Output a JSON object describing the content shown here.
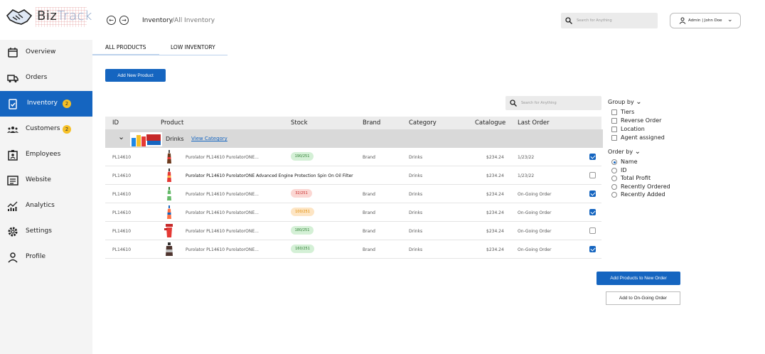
{
  "app": {
    "brand_first": "Biz",
    "brand_second": "Track"
  },
  "colors": {
    "primary": "#1565c0",
    "badge": "#f6c026",
    "sidebar_bg": "#f4f4f4"
  },
  "sidebar": {
    "items": [
      {
        "label": "Overview",
        "icon": "calendar-icon"
      },
      {
        "label": "Orders",
        "icon": "truck-icon"
      },
      {
        "label": "Inventory",
        "icon": "clipboard-check-icon",
        "badge": "2",
        "active": true
      },
      {
        "label": "Customers",
        "icon": "users-icon",
        "badge": "2"
      },
      {
        "label": "Employees",
        "icon": "id-badge-icon"
      },
      {
        "label": "Website",
        "icon": "browser-icon"
      },
      {
        "label": "Analytics",
        "icon": "chart-icon"
      },
      {
        "label": "Settings",
        "icon": "gear-icon"
      },
      {
        "label": "Profile",
        "icon": "user-icon"
      }
    ]
  },
  "topbar": {
    "breadcrumb_current": "Inventory",
    "breadcrumb_sub": "/All Inventory",
    "search_placeholder": "Search for Anything",
    "user_label": "Admin | John Doe"
  },
  "tabs": [
    {
      "label": "ALL PRODUCTS",
      "active": true
    },
    {
      "label": "LOW INVENTORY"
    }
  ],
  "add_product_label": "Add New Product",
  "table_search_placeholder": "Search for Anything",
  "table": {
    "columns": [
      "ID",
      "Product",
      "Stock",
      "Brand",
      "Category",
      "Catalogue",
      "Last Order"
    ],
    "group": {
      "name": "Drinks",
      "link": "View Category"
    },
    "rows": [
      {
        "id": "PL14610",
        "product": "Purolator PL14610 PurolatorONE...",
        "stock": "190/251",
        "stock_tone": "green",
        "brand": "Brand",
        "category": "Drinks",
        "catalogue": "$234.24",
        "last_order": "1/23/22",
        "checked": true
      },
      {
        "id": "PL14610",
        "product": "Purolator PL14610 PurolatorONE Advanced Engine Protection Spin On Oil Filter",
        "stock": "",
        "stock_tone": "",
        "brand": "",
        "category": "Drinks",
        "catalogue": "$234.24",
        "last_order": "1/23/22",
        "checked": false
      },
      {
        "id": "PL14610",
        "product": "Purolator PL14610 PurolatorONE...",
        "stock": "32/251",
        "stock_tone": "red",
        "brand": "Brand",
        "category": "Drinks",
        "catalogue": "$234.24",
        "last_order": "On-Going Order",
        "checked": true
      },
      {
        "id": "PL14610",
        "product": "Purolator PL14610 PurolatorONE...",
        "stock": "100/251",
        "stock_tone": "orange",
        "brand": "Brand",
        "category": "Drinks",
        "catalogue": "$234.24",
        "last_order": "On-Going Order",
        "checked": true
      },
      {
        "id": "PL14610",
        "product": "Purolator PL14610 PurolatorONE...",
        "stock": "180/251",
        "stock_tone": "green",
        "brand": "Brand",
        "category": "Drinks",
        "catalogue": "$234.24",
        "last_order": "On-Going Order",
        "checked": false
      },
      {
        "id": "PL14610",
        "product": "Purolator PL14610 PurolatorONE...",
        "stock": "160/251",
        "stock_tone": "green",
        "brand": "Brand",
        "category": "Drinks",
        "catalogue": "$234.24",
        "last_order": "On-Going Order",
        "checked": true
      }
    ]
  },
  "filters": {
    "group_by_label": "Group by",
    "group_by": [
      "Tiers",
      "Reverse Order",
      "Location",
      "Agent assigned"
    ],
    "order_by_label": "Order by",
    "order_by": [
      {
        "label": "Name",
        "selected": true
      },
      {
        "label": "ID"
      },
      {
        "label": "Total Profit"
      },
      {
        "label": "Recently Ordered"
      },
      {
        "label": "Recently Added"
      }
    ]
  },
  "actions": {
    "add_to_new": "Add Products to New Order",
    "add_to_ongoing": "Add to On-Going Order"
  }
}
